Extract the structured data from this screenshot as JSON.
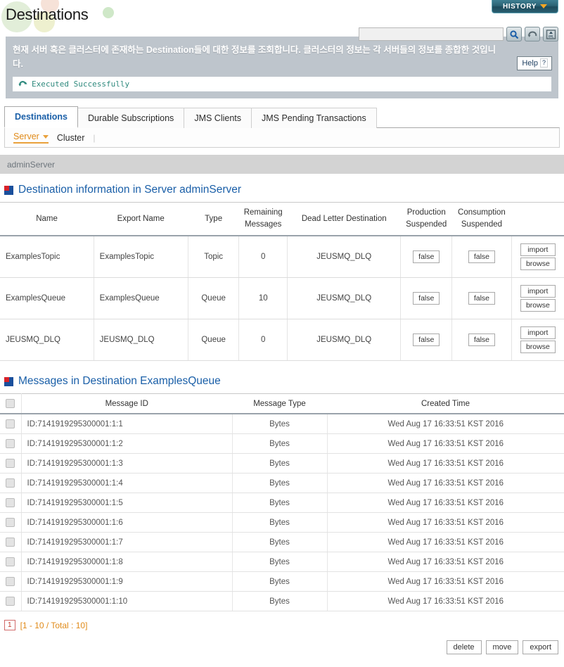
{
  "header": {
    "page_title": "Destinations",
    "history_button": "HISTORY",
    "history_chevron_icon": "chevron-down-icon"
  },
  "search": {
    "value": "",
    "placeholder": "",
    "icons": [
      "search-icon",
      "refresh-icon",
      "xml-export-icon"
    ]
  },
  "description": {
    "text": "현재 서버 혹은 클러스터에 존재하는 Destination들에 대한 정보를 조회합니다. 클러스터의 정보는 각 서버들의 정보를 종합한 것입니다.",
    "help_label": "Help",
    "help_mark": "?",
    "status_icon": "refresh-success-icon",
    "status_text": "Executed Successfully"
  },
  "tabs": [
    {
      "label": "Destinations",
      "active": true
    },
    {
      "label": "Durable Subscriptions",
      "active": false
    },
    {
      "label": "JMS Clients",
      "active": false
    },
    {
      "label": "JMS Pending Transactions",
      "active": false
    }
  ],
  "subnav": {
    "items": [
      {
        "label": "Server",
        "active": true
      },
      {
        "label": "Cluster",
        "active": false
      }
    ],
    "separator": "|"
  },
  "server_bar": {
    "name": "adminServer"
  },
  "destinations_section": {
    "icon": "section-marker-icon",
    "title": "Destination information in Server adminServer",
    "columns": [
      "Name",
      "Export Name",
      "Type",
      "Remaining Messages",
      "Dead Letter Destination",
      "Production Suspended",
      "Consumption Suspended",
      ""
    ],
    "column_lines": [
      [
        "Name",
        ""
      ],
      [
        "Export Name",
        ""
      ],
      [
        "Type",
        ""
      ],
      [
        "Remaining",
        "Messages"
      ],
      [
        "Dead Letter Destination",
        ""
      ],
      [
        "Production",
        "Suspended"
      ],
      [
        "Consumption",
        "Suspended"
      ],
      [
        "",
        ""
      ]
    ],
    "rows": [
      {
        "name": "ExamplesTopic",
        "export_name": "ExamplesTopic",
        "type": "Topic",
        "remaining_messages": "0",
        "dead_letter_destination": "JEUSMQ_DLQ",
        "production_suspended": "false",
        "consumption_suspended": "false",
        "import_label": "import",
        "browse_label": "browse"
      },
      {
        "name": "ExamplesQueue",
        "export_name": "ExamplesQueue",
        "type": "Queue",
        "remaining_messages": "10",
        "dead_letter_destination": "JEUSMQ_DLQ",
        "production_suspended": "false",
        "consumption_suspended": "false",
        "import_label": "import",
        "browse_label": "browse"
      },
      {
        "name": "JEUSMQ_DLQ",
        "export_name": "JEUSMQ_DLQ",
        "type": "Queue",
        "remaining_messages": "0",
        "dead_letter_destination": "JEUSMQ_DLQ",
        "production_suspended": "false",
        "consumption_suspended": "false",
        "import_label": "import",
        "browse_label": "browse"
      }
    ]
  },
  "messages_section": {
    "icon": "section-marker-icon",
    "title": "Messages in Destination ExamplesQueue",
    "columns": [
      "",
      "Message ID",
      "Message Type",
      "Created Time"
    ],
    "rows": [
      {
        "id": "ID:7141919295300001:1:1",
        "type": "Bytes",
        "created": "Wed Aug 17 16:33:51 KST 2016"
      },
      {
        "id": "ID:7141919295300001:1:2",
        "type": "Bytes",
        "created": "Wed Aug 17 16:33:51 KST 2016"
      },
      {
        "id": "ID:7141919295300001:1:3",
        "type": "Bytes",
        "created": "Wed Aug 17 16:33:51 KST 2016"
      },
      {
        "id": "ID:7141919295300001:1:4",
        "type": "Bytes",
        "created": "Wed Aug 17 16:33:51 KST 2016"
      },
      {
        "id": "ID:7141919295300001:1:5",
        "type": "Bytes",
        "created": "Wed Aug 17 16:33:51 KST 2016"
      },
      {
        "id": "ID:7141919295300001:1:6",
        "type": "Bytes",
        "created": "Wed Aug 17 16:33:51 KST 2016"
      },
      {
        "id": "ID:7141919295300001:1:7",
        "type": "Bytes",
        "created": "Wed Aug 17 16:33:51 KST 2016"
      },
      {
        "id": "ID:7141919295300001:1:8",
        "type": "Bytes",
        "created": "Wed Aug 17 16:33:51 KST 2016"
      },
      {
        "id": "ID:7141919295300001:1:9",
        "type": "Bytes",
        "created": "Wed Aug 17 16:33:51 KST 2016"
      },
      {
        "id": "ID:7141919295300001:1:10",
        "type": "Bytes",
        "created": "Wed Aug 17 16:33:51 KST 2016"
      }
    ],
    "pagination": {
      "current_page": "1",
      "info": "[1 - 10 / Total : 10]"
    },
    "footer_buttons": [
      "delete",
      "move",
      "export"
    ]
  },
  "colors": {
    "accent_blue": "#1a5fa8",
    "accent_orange": "#e08a18",
    "history_teal": "#2c6375",
    "desc_panel": "#b6bec6",
    "status_green": "#2f8a7e",
    "server_bar": "#d3d3d3"
  }
}
